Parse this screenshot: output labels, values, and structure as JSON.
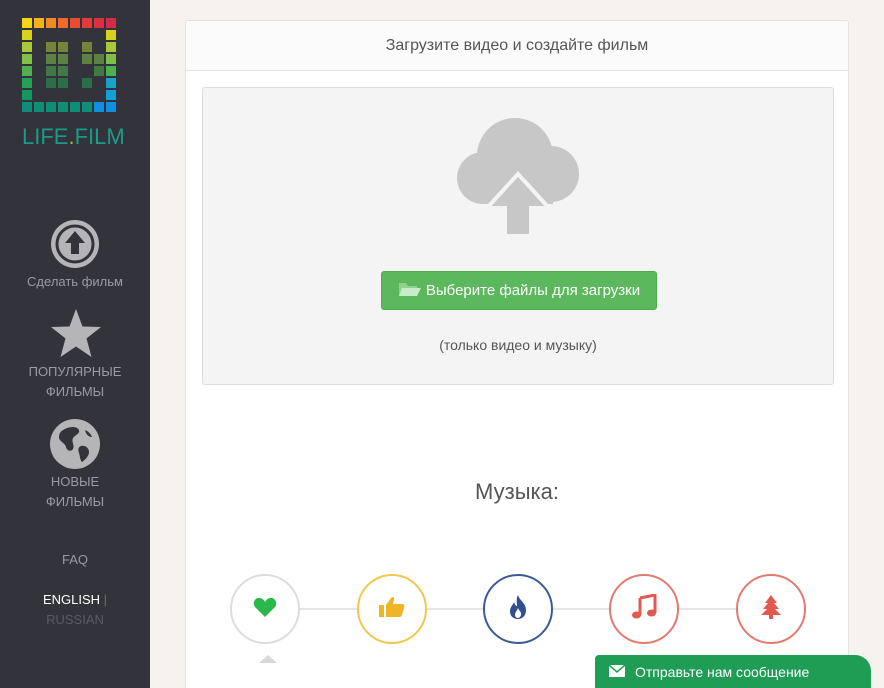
{
  "brand": {
    "logo_text_1": "LIFE",
    "logo_text_dot": ".",
    "logo_text_2": "FILM"
  },
  "sidebar": {
    "items": [
      {
        "label": "Сделать фильм",
        "icon": "upload-circle-icon"
      },
      {
        "label_line1": "ПОПУЛЯРНЫЕ",
        "label_line2": "ФИЛЬМЫ",
        "icon": "star-icon"
      },
      {
        "label_line1": "НОВЫЕ",
        "label_line2": "ФИЛЬМЫ",
        "icon": "globe-icon"
      }
    ],
    "faq": "FAQ",
    "lang_english": "ENGLISH",
    "lang_separator": "|",
    "lang_russian": "RUSSIAN"
  },
  "card": {
    "title": "Загрузите видео и создайте фильм",
    "upload_button": "Выберите файлы для загрузки",
    "upload_note": "(только видео и музыку)"
  },
  "music": {
    "title": "Музыка:",
    "genres": [
      {
        "icon": "heart-icon",
        "color": "#2bb84a",
        "border": "#dddddd"
      },
      {
        "icon": "thumbs-up-icon",
        "color": "#f0b429",
        "border": "#f0c84a"
      },
      {
        "icon": "fire-icon",
        "color": "#2f4f8f",
        "border": "#3b5a96"
      },
      {
        "icon": "music-note-icon",
        "color": "#e05a4f",
        "border": "#e27a70"
      },
      {
        "icon": "tree-icon",
        "color": "#e05a4f",
        "border": "#e27a70"
      }
    ]
  },
  "feedback": {
    "label": "Отправьте нам сообщение"
  },
  "colors": {
    "sidebar": "#33343b",
    "accent_green": "#5cb85c",
    "feedback_green": "#1f9d55"
  }
}
